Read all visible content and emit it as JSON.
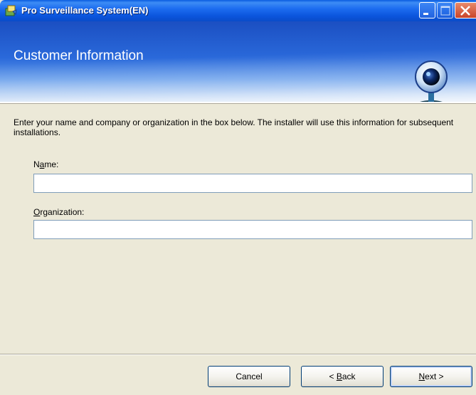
{
  "window": {
    "title": "Pro Surveillance System(EN)"
  },
  "banner": {
    "heading": "Customer Information"
  },
  "intro_text": "Enter your name and company or organization in the box below. The installer will use this information for subsequent installations.",
  "fields": {
    "name": {
      "label_pre": "N",
      "label_accel": "a",
      "label_post": "me:",
      "value": ""
    },
    "organization": {
      "label_pre": "",
      "label_accel": "O",
      "label_post": "rganization:",
      "value": ""
    }
  },
  "buttons": {
    "cancel": {
      "label": "Cancel"
    },
    "back": {
      "prefix": "< ",
      "accel": "B",
      "rest": "ack"
    },
    "next": {
      "accel": "N",
      "rest": "ext >"
    }
  },
  "colors": {
    "titlebar": "#0a5ce0",
    "dialog_bg": "#ece9d8",
    "close_button": "#c9442a"
  }
}
